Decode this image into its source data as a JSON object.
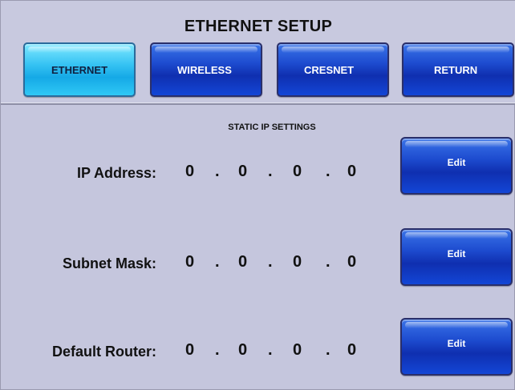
{
  "header": {
    "title": "ETHERNET SETUP"
  },
  "tabs": [
    {
      "label": "ETHERNET",
      "active": true
    },
    {
      "label": "WIRELESS",
      "active": false
    },
    {
      "label": "CRESNET",
      "active": false
    },
    {
      "label": "RETURN",
      "active": false
    }
  ],
  "section": {
    "label": "STATIC IP SETTINGS"
  },
  "rows": [
    {
      "label": "IP Address:",
      "octets": [
        "0",
        "0",
        "0",
        "0"
      ],
      "edit_label": "Edit"
    },
    {
      "label": "Subnet Mask:",
      "octets": [
        "0",
        "0",
        "0",
        "0"
      ],
      "edit_label": "Edit"
    },
    {
      "label": "Default Router:",
      "octets": [
        "0",
        "0",
        "0",
        "0"
      ],
      "edit_label": "Edit"
    }
  ],
  "separator": ".",
  "colors": {
    "active_tab": "#36c3f3",
    "button": "#1d4bcf",
    "background": "#c5c6dd"
  }
}
